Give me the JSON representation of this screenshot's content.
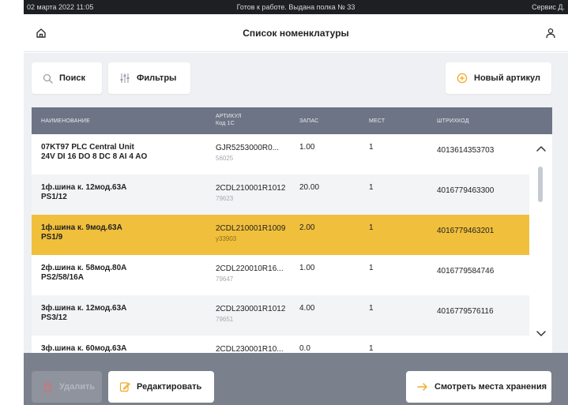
{
  "status": {
    "datetime": "02 марта 2022 11:05",
    "message": "Готов к работе. Выдана полка № 33",
    "user": "Сервис Д."
  },
  "header": {
    "title": "Список номенклатуры",
    "home_icon": "home-icon",
    "user_icon": "user-icon"
  },
  "toolbar": {
    "search_label": "Поиск",
    "filters_label": "Фильтры",
    "new_label": "Новый артикул"
  },
  "table": {
    "columns": {
      "name": "НАИМЕНОВАНИЕ",
      "article": "АРТИКУЛ",
      "article_sub": "Код 1С",
      "stock": "ЗАПАС",
      "places": "МЕСТ",
      "barcode": "ШТРИХКОД"
    },
    "rows": [
      {
        "name_1": "07KT97 PLC Central Unit",
        "name_2": "24V DI 16 DO 8 DC 8 AI 4 AO",
        "article": "GJR5253000R0...",
        "code": "56025",
        "stock": "1.00",
        "places": "1",
        "barcode": "4013614353703",
        "selected": false
      },
      {
        "name_1": "1ф.шина к. 12мод.63А",
        "name_2": "PS1/12",
        "article": "2CDL210001R1012",
        "code": "79623",
        "stock": "20.00",
        "places": "1",
        "barcode": "4016779463300",
        "selected": false
      },
      {
        "name_1": "1ф.шина к. 9мод.63А",
        "name_2": "PS1/9",
        "article": "2CDL210001R1009",
        "code": "у33903",
        "stock": "2.00",
        "places": "1",
        "barcode": "4016779463201",
        "selected": true
      },
      {
        "name_1": "2ф.шина к. 58мод.80А",
        "name_2": "PS2/58/16A",
        "article": "2CDL220010R16...",
        "code": "79647",
        "stock": "1.00",
        "places": "1",
        "barcode": "4016779584746",
        "selected": false
      },
      {
        "name_1": "3ф.шина к. 12мод.63А",
        "name_2": "PS3/12",
        "article": "2CDL230001R1012",
        "code": "79651",
        "stock": "4.00",
        "places": "1",
        "barcode": "4016779576116",
        "selected": false
      },
      {
        "name_1": "3ф.шина к. 60мод.63А",
        "name_2": "",
        "article": "2CDL230001R10...",
        "code": "",
        "stock": "0.0",
        "places": "1",
        "barcode": "",
        "selected": false
      }
    ]
  },
  "footer": {
    "delete_label": "Удалить",
    "edit_label": "Редактировать",
    "storage_label": "Смотреть места хранения"
  },
  "colors": {
    "accent": "#f0bf3c",
    "header_bg": "#6d7485",
    "status_bg": "#1d1f22",
    "footer_bg": "#7a808c",
    "new_icon": "#f0a928",
    "storage_arrow": "#f0a928"
  }
}
